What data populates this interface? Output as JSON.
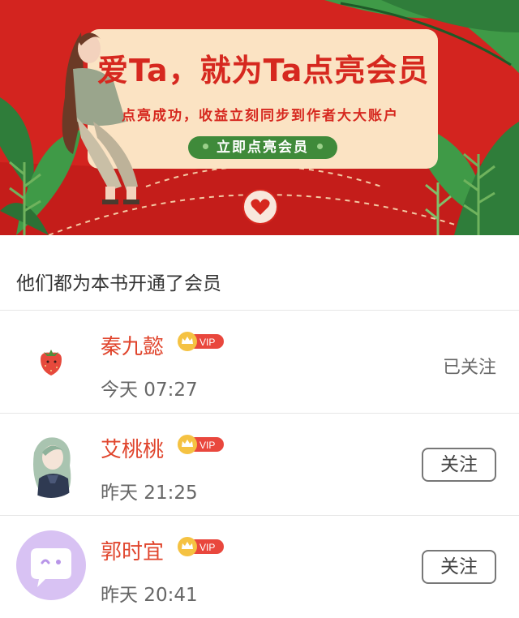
{
  "banner": {
    "headline": "爱Ta，就为Ta点亮会员",
    "subline": "点亮成功，收益立刻同步到作者大大账户",
    "cta_label": "立即点亮会员"
  },
  "section_title": "他们都为本书开通了会员",
  "vip_badge_label": "VIP",
  "members": [
    {
      "name": "秦九懿",
      "time": "今天 07:27",
      "action": "已关注"
    },
    {
      "name": "艾桃桃",
      "time": "昨天 21:25",
      "action": "关注"
    },
    {
      "name": "郭时宜",
      "time": "昨天 20:41",
      "action": "关注"
    }
  ],
  "colors": {
    "banner_red": "#d3241f",
    "card_cream": "#fbe3c3",
    "cta_green": "#3f8a3a",
    "name_orange": "#e0452d",
    "vip_gold": "#f5c242",
    "vip_red": "#e9473d",
    "avatar_purple": "#d8c2f3"
  }
}
